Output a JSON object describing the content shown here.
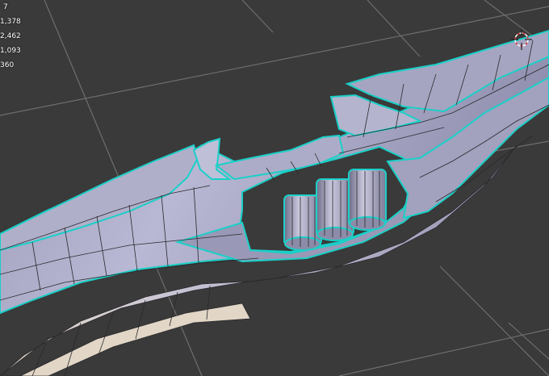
{
  "viewport": {
    "background": "#3a3a3a",
    "grid_color": "#6e6e6e",
    "mesh_fill": "#a9a8c2",
    "mesh_edge": "#2a2a2e",
    "mesh_selected_edge": "#1ad0c8",
    "highlight": "#efe2d3"
  },
  "stats": {
    "rows": [
      "7",
      "1,378",
      "2,462",
      "1,093",
      "360"
    ]
  },
  "gizmo": {
    "icon": "3d-cursor-icon"
  }
}
